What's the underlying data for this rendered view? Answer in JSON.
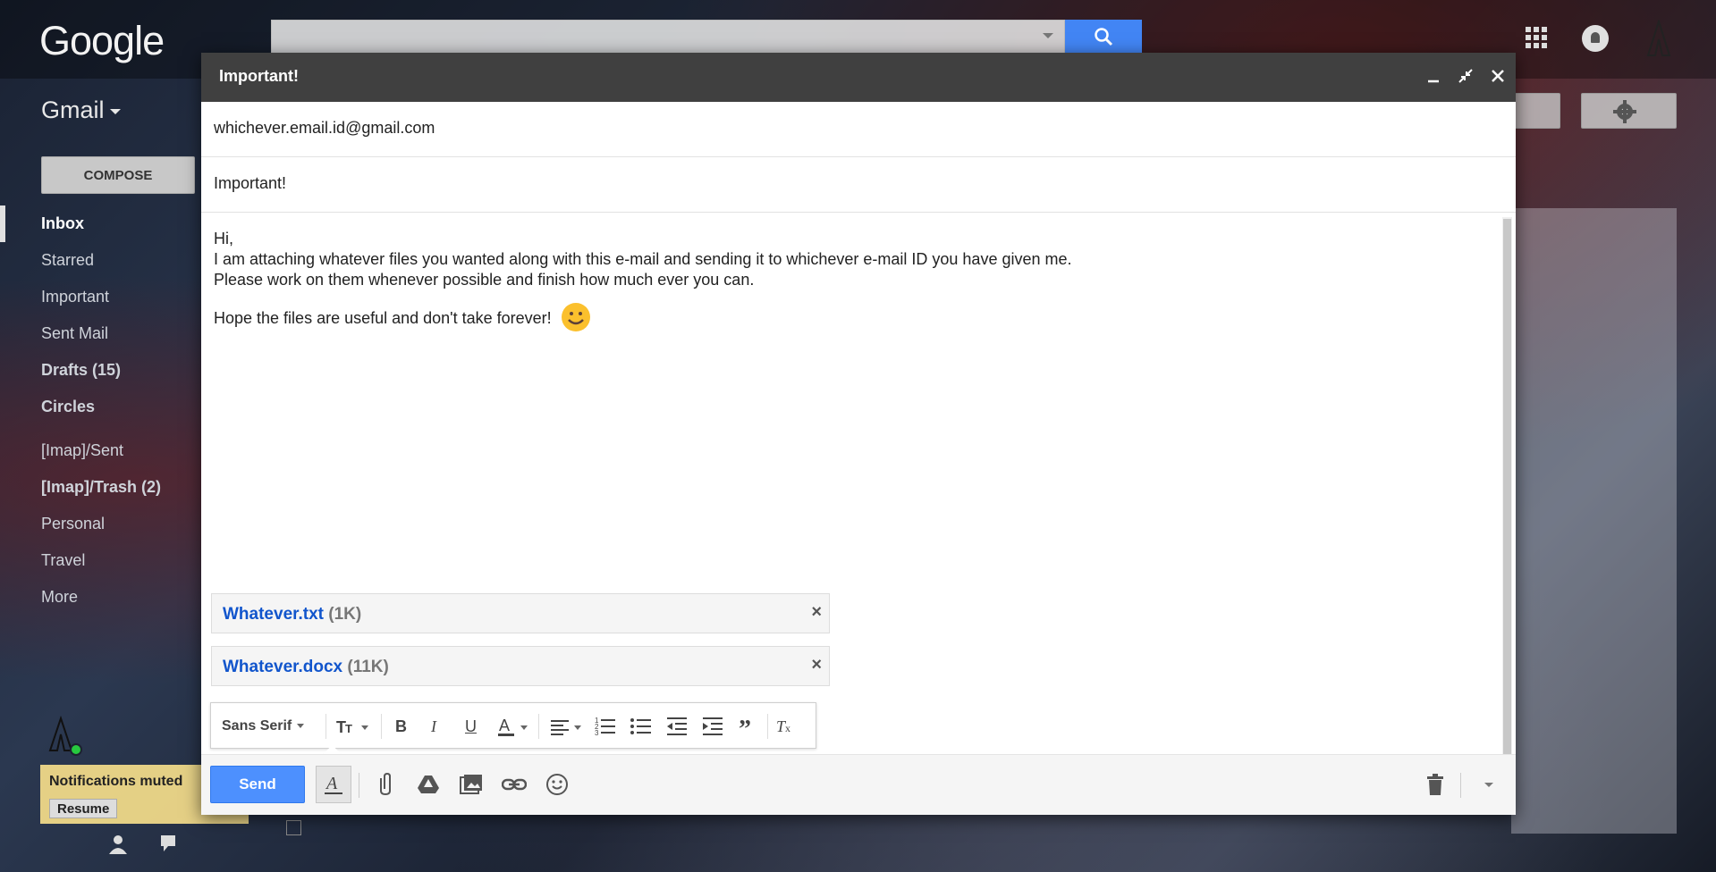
{
  "brand": {
    "logo": "Google",
    "app_label": "Gmail"
  },
  "search": {
    "placeholder": ""
  },
  "compose_button": {
    "label": "COMPOSE"
  },
  "sidebar": {
    "items": [
      {
        "label": "Inbox"
      },
      {
        "label": "Starred"
      },
      {
        "label": "Important"
      },
      {
        "label": "Sent Mail"
      },
      {
        "label": "Drafts (15)"
      },
      {
        "label": "Circles"
      },
      {
        "label": "[Imap]/Sent"
      },
      {
        "label": "[Imap]/Trash (2)"
      },
      {
        "label": "Personal"
      },
      {
        "label": "Travel"
      },
      {
        "label": "More"
      }
    ]
  },
  "notifications": {
    "text": "Notifications muted",
    "resume_label": "Resume"
  },
  "compose": {
    "title": "Important!",
    "to": "whichever.email.id@gmail.com",
    "subject": "Important!",
    "body": {
      "line1": "Hi,",
      "line2": "I am attaching whatever files you wanted along with this e-mail and sending it to whichever e-mail ID you have given me.",
      "line3": "Please work on them whenever possible and finish how much ever you can.",
      "line4": "Hope the files are useful and don't take forever!"
    },
    "attachments": [
      {
        "name": "Whatever.txt",
        "size": "(1K)"
      },
      {
        "name": "Whatever.docx",
        "size": "(11K)"
      }
    ],
    "format_bar": {
      "font": "Sans Serif"
    },
    "send_label": "Send"
  },
  "colors": {
    "send_blue": "#4d90fe",
    "link_blue": "#1155cc",
    "header_dark": "#404040"
  }
}
